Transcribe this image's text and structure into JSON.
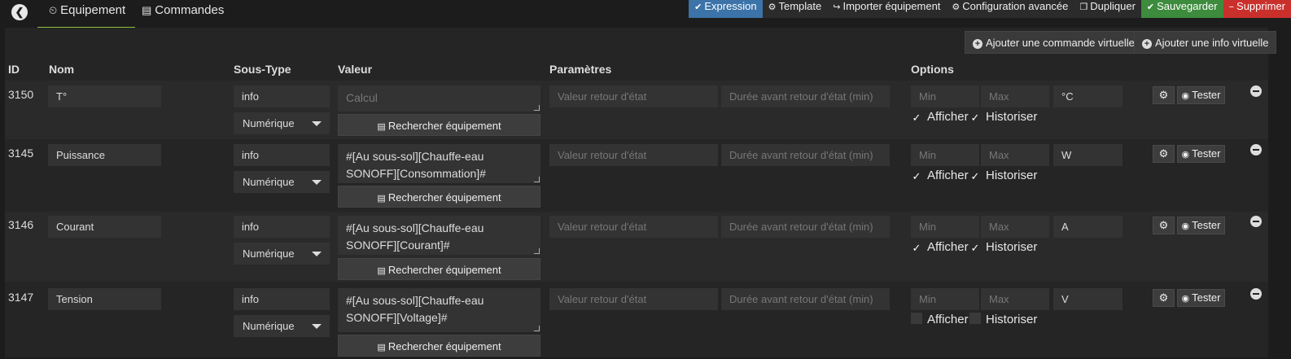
{
  "tabs": [
    {
      "label": "Equipement",
      "icon": "tachometer-icon",
      "glyph": "⏲"
    },
    {
      "label": "Commandes",
      "icon": "list-icon",
      "glyph": "▤"
    }
  ],
  "back_glyph": "❮",
  "actions": [
    {
      "label": "Expression",
      "glyph": "✔",
      "icon": "check-icon"
    },
    {
      "label": "Template",
      "glyph": "⚙",
      "icon": "cubes-icon"
    },
    {
      "label": "Importer équipement",
      "glyph": "↪",
      "icon": "share-icon"
    },
    {
      "label": "Configuration avancée",
      "glyph": "⚙",
      "icon": "cogs-icon"
    },
    {
      "label": "Dupliquer",
      "glyph": "❐",
      "icon": "copy-icon"
    },
    {
      "label": "Sauvegarder",
      "glyph": "✔",
      "icon": "check-circle-icon"
    },
    {
      "label": "Supprimer",
      "glyph": "−",
      "icon": "minus-circle-icon"
    }
  ],
  "virtual_buttons": {
    "add_command": "Ajouter une commande virtuelle",
    "add_info": "Ajouter une info virtuelle",
    "glyph": "+"
  },
  "headers": {
    "id": "ID",
    "nom": "Nom",
    "sous_type": "Sous-Type",
    "valeur": "Valeur",
    "parametres": "Paramètres",
    "options": "Options"
  },
  "placeholders": {
    "valeur_retour": "Valeur retour d'état",
    "duree_retour": "Durée avant retour d'état (min)",
    "min": "Min",
    "max": "Max",
    "calcul": "Calcul"
  },
  "labels": {
    "rechercher": "Rechercher équipement",
    "rechercher_glyph": "▤",
    "afficher": "Afficher",
    "historiser": "Historiser",
    "tester": "Tester",
    "tester_glyph": "◉",
    "config_glyph": "⚙",
    "check": "✓"
  },
  "rows": [
    {
      "id": "3150",
      "nom": "T°",
      "type": "info",
      "subtype": "Numérique",
      "valeur": "",
      "unite": "°C",
      "afficher": true,
      "historiser": true
    },
    {
      "id": "3145",
      "nom": "Puissance",
      "type": "info",
      "subtype": "Numérique",
      "valeur": "#[Au sous-sol][Chauffe-eau SONOFF][Consommation]#",
      "unite": "W",
      "afficher": true,
      "historiser": true
    },
    {
      "id": "3146",
      "nom": "Courant",
      "type": "info",
      "subtype": "Numérique",
      "valeur": "#[Au sous-sol][Chauffe-eau SONOFF][Courant]#",
      "unite": "A",
      "afficher": true,
      "historiser": true
    },
    {
      "id": "3147",
      "nom": "Tension",
      "type": "info",
      "subtype": "Numérique",
      "valeur": "#[Au sous-sol][Chauffe-eau SONOFF][Voltage]#",
      "unite": "V",
      "afficher": false,
      "historiser": false
    }
  ]
}
